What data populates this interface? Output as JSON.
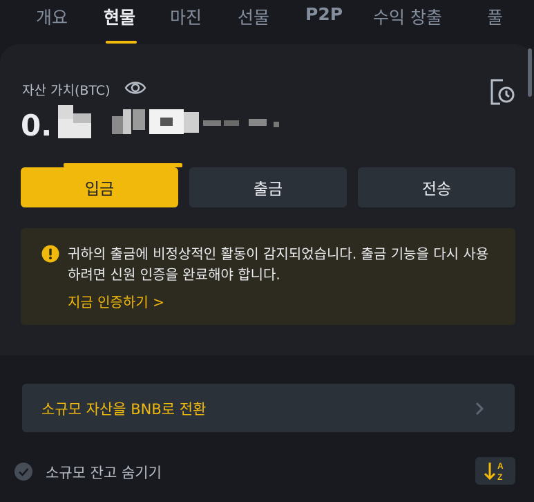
{
  "tabs": [
    {
      "label": "개요"
    },
    {
      "label": "현물"
    },
    {
      "label": "마진"
    },
    {
      "label": "선물"
    },
    {
      "label": "P2P"
    },
    {
      "label": "수익 창출"
    },
    {
      "label": "풀"
    }
  ],
  "active_tab": "현물",
  "asset": {
    "label": "자산 가치(BTC)",
    "balance_prefix": "0."
  },
  "actions": {
    "deposit": "입금",
    "withdraw": "출금",
    "transfer": "전송"
  },
  "alert": {
    "message": "귀하의 출금에 비정상적인 활동이 감지되었습니다. 출금 기능을 다시 사용하려면 신원 인증을 완료해야 합니다.",
    "link": "지금 인증하기 >"
  },
  "convert": {
    "label": "소규모 자산을 BNB로 전환"
  },
  "hide_small": {
    "label": "소규모 잔고 숨기기"
  },
  "colors": {
    "accent": "#f0b90b",
    "background": "#181a20",
    "card": "#1e2026",
    "button": "#2b3139"
  },
  "icons": [
    "eye-icon",
    "history-icon",
    "warning-icon",
    "chevron-right-icon",
    "check-circle-icon",
    "sort-az-icon"
  ]
}
